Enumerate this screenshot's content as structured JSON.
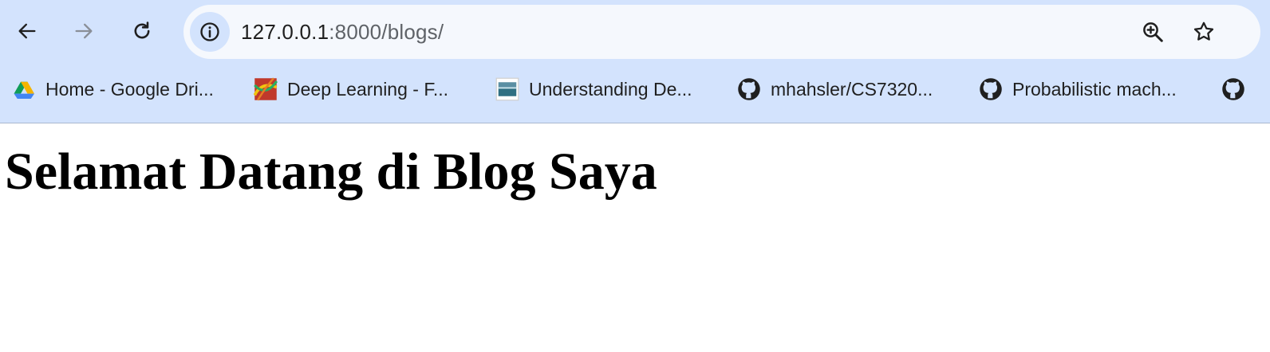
{
  "browser": {
    "url_host": "127.0.0.1",
    "url_rest": ":8000/blogs/",
    "icons": {
      "back": "arrow-left-icon",
      "forward": "arrow-right-icon",
      "reload": "reload-icon",
      "site_info": "info-icon",
      "zoom": "zoom-in-icon",
      "bookmark": "star-icon"
    },
    "colors": {
      "chrome_bg": "#d3e3fd",
      "omnibox_bg": "#f5f8fd"
    }
  },
  "bookmarks": [
    {
      "label": "Home - Google Dri...",
      "icon": "google-drive-icon"
    },
    {
      "label": "Deep Learning - F...",
      "icon": "thumbnail-icon"
    },
    {
      "label": "Understanding De...",
      "icon": "thumbnail-icon"
    },
    {
      "label": "mhahsler/CS7320...",
      "icon": "github-icon"
    },
    {
      "label": "Probabilistic mach...",
      "icon": "github-icon"
    },
    {
      "label": "",
      "icon": "github-icon"
    }
  ],
  "page": {
    "title": "Selamat Datang di Blog Saya"
  }
}
